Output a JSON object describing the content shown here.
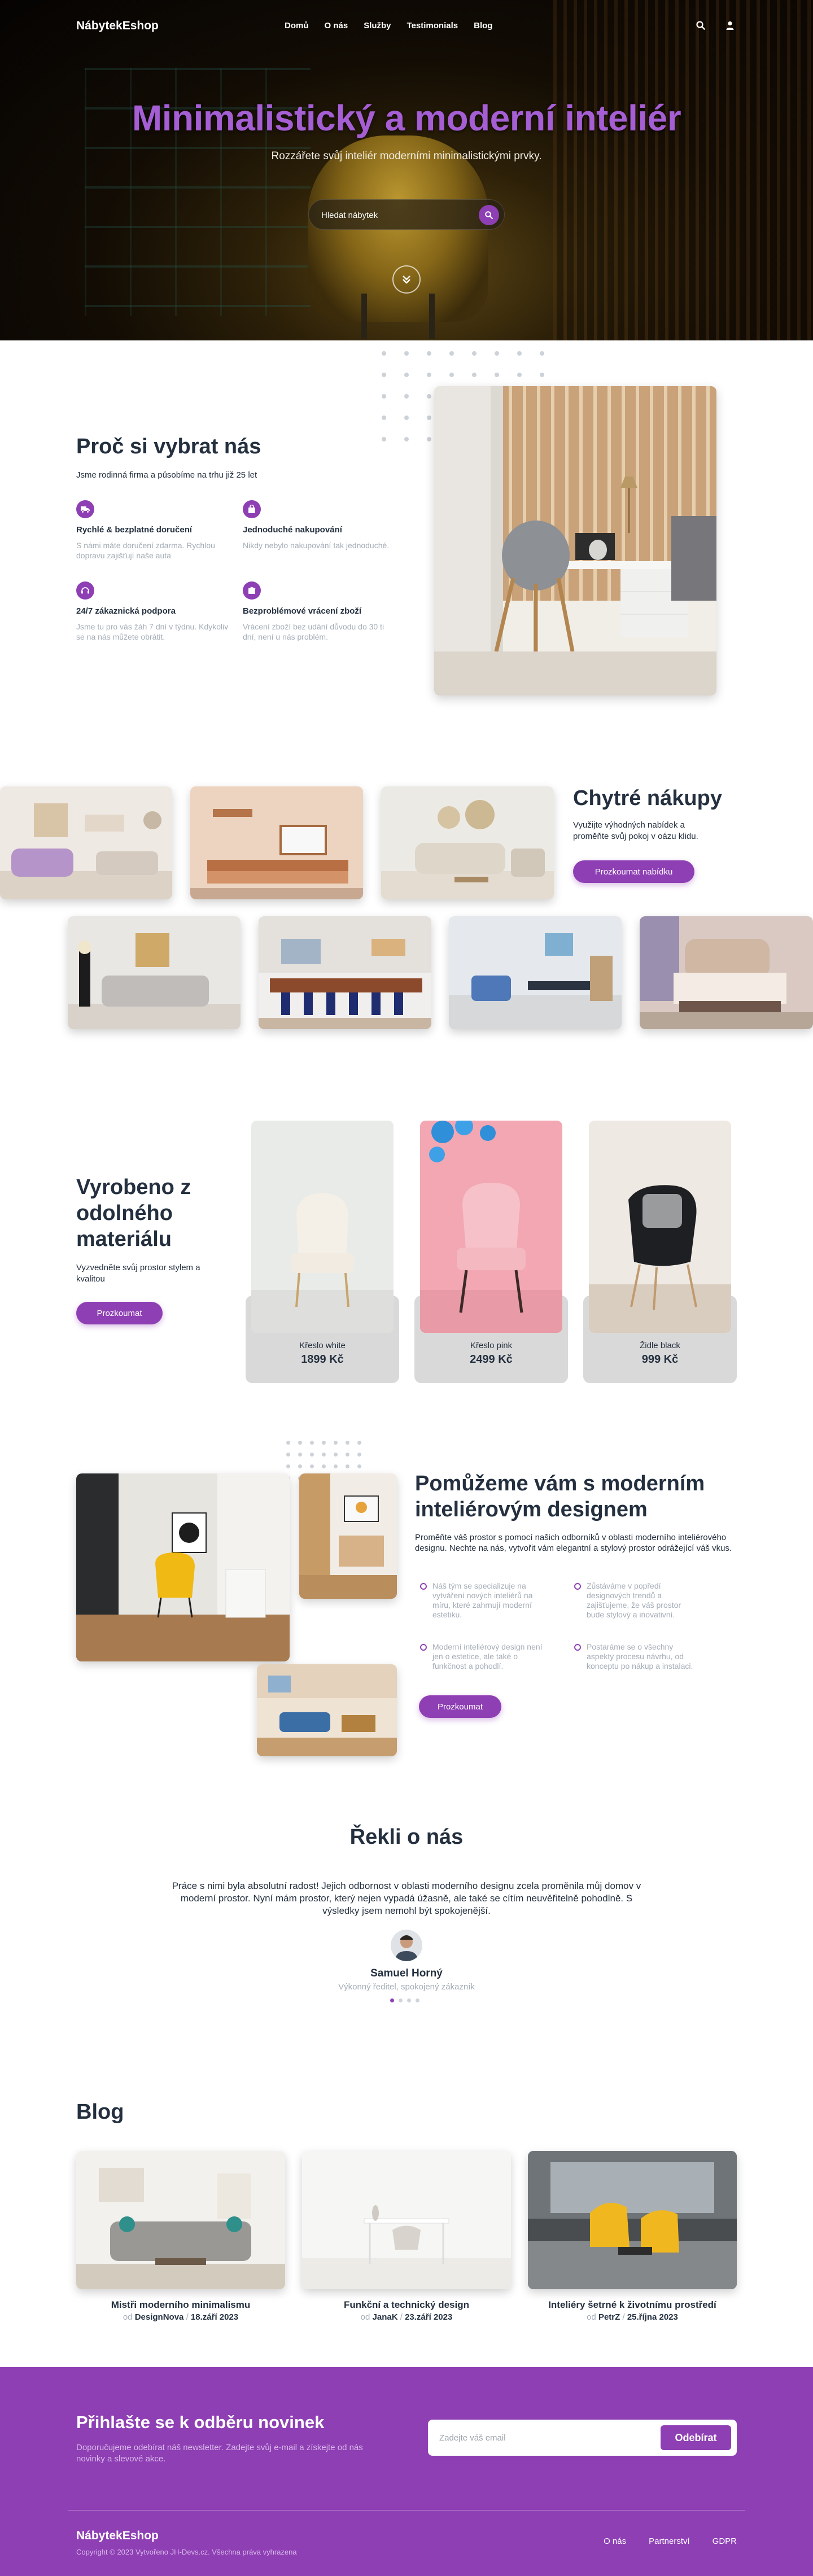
{
  "nav": {
    "logo": "NábytekEshop",
    "links": [
      "Domů",
      "O nás",
      "Služby",
      "Testimonials",
      "Blog"
    ],
    "icons": [
      "search-icon",
      "user-icon"
    ]
  },
  "hero": {
    "title": "Minimalistický a moderní inteliér",
    "subtitle": "Rozzářete svůj inteliér moderními minimalistickými prvky.",
    "search_placeholder": "Hledat nábytek",
    "title_color": "#a55ed3"
  },
  "why": {
    "title": "Proč si vybrat nás",
    "subtitle": "Jsme rodinná firma a působíme na trhu již 25 let",
    "features": [
      {
        "title": "Rychlé & bezplatné doručení",
        "desc": "S námi máte doručení zdarma. Rychlou dopravu zajišťují naše auta"
      },
      {
        "title": "Jednoduché nakupování",
        "desc": "Nikdy nebylo nakupování tak jednoduché."
      },
      {
        "title": "24/7 zákaznická podpora",
        "desc": "Jsme tu pro vás žáh 7 dní v týdnu. Kdykoliv se na nás můžete obrátit."
      },
      {
        "title": "Bezproblémové vrácení zboží",
        "desc": "Vrácení zboží bez udání důvodu do 30 ti dní, není u nás problém."
      }
    ]
  },
  "smart": {
    "title": "Chytré nákupy",
    "desc": "Využijte výhodných nabídek a proměňte svůj pokoj v oázu klidu.",
    "button": "Prozkoumat nabídku"
  },
  "materials": {
    "title": "Vyrobeno z odolného materiálu",
    "desc": "Vyzvedněte svůj prostor stylem a kvalitou",
    "button": "Prozkoumat",
    "products": [
      {
        "name": "Křeslo white",
        "price": "1899 Kč"
      },
      {
        "name": "Křeslo pink",
        "price": "2499 Kč"
      },
      {
        "name": "Židle black",
        "price": "999 Kč"
      }
    ]
  },
  "help": {
    "title": "Pomůžeme vám s moderním inteliérovým designem",
    "desc": "Proměňte váš prostor s pomocí našich odborníků v oblasti moderního inteliérového designu. Nechte na nás, vytvořit vám elegantní a stylový prostor odrážející váš vkus.",
    "bullets": [
      "Náš tým se specializuje na vytváření nových inteliérů na míru, které zahrnují moderní estetiku.",
      "Zůstáváme v popředí designových trendů a zajišťujeme, že váš prostor bude stylový a inovativní.",
      "Moderní inteliérový design není jen o estetice, ale také o funkčnost a pohodlí.",
      "Postaráme se o všechny aspekty procesu návrhu, od konceptu po nákup a instalaci."
    ],
    "button": "Prozkoumat"
  },
  "testimonials": {
    "title": "Řekli o nás",
    "quote": "Práce s nimi byla absolutní radost! Jejich odbornost v oblasti moderního designu zcela proměnila můj domov v moderní prostor. Nyní mám prostor, který nejen vypadá úžasně, ale také se cítím neuvěřitelně pohodlně. S výsledky jsem nemohl být spokojenější.",
    "name": "Samuel Horný",
    "role": "Výkonný ředitel, spokojený zákazník"
  },
  "blog": {
    "title": "Blog",
    "by": "od",
    "posts": [
      {
        "title": "Mistři moderního minimalismu",
        "author": "DesignNova",
        "date": "18.září 2023"
      },
      {
        "title": "Funkční a technický design",
        "author": "JanaK",
        "date": "23.září 2023"
      },
      {
        "title": "Inteliéry šetrné k životnímu prostředí",
        "author": "PetrZ",
        "date": "25.října 2023"
      }
    ]
  },
  "newsletter": {
    "title": "Přihlašte se k odběru novinek",
    "desc": "Doporučujeme odebírat náš newsletter. Zadejte svůj e-mail a získejte od nás novinky a slevové akce.",
    "placeholder": "Zadejte váš email",
    "button": "Odebírat"
  },
  "footer": {
    "logo": "NábytekEshop",
    "copyright": "Copyright © 2023 Vytvořeno JH-Devs.cz. Všechna práva vyhrazena",
    "links": [
      "O nás",
      "Partnerství",
      "GDPR"
    ]
  },
  "colors": {
    "accent": "#8e3fb4",
    "text": "#24303f",
    "muted": "#a4acb6"
  }
}
